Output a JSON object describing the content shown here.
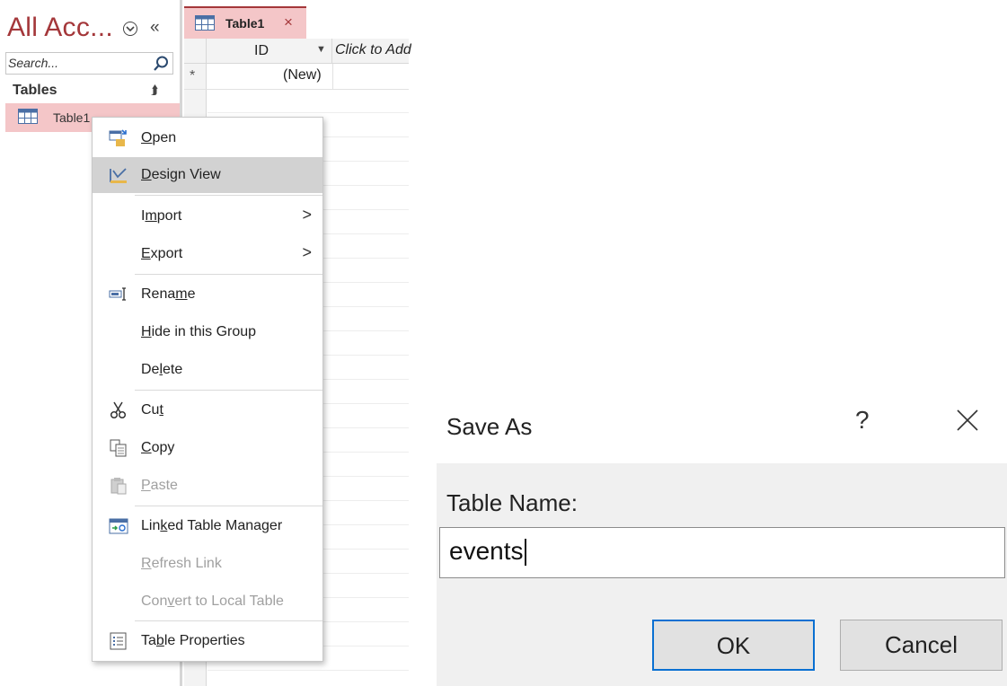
{
  "nav": {
    "title": "All Acc...",
    "search_placeholder": "Search...",
    "group_label": "Tables",
    "items": [
      {
        "label": "Table1",
        "selected": true
      }
    ]
  },
  "tab": {
    "label": "Table1",
    "close_glyph": "×"
  },
  "grid": {
    "columns": [
      {
        "label": "ID"
      },
      {
        "label": "Click to Add"
      }
    ],
    "new_row": {
      "marker": "*",
      "id_value": "(New)"
    }
  },
  "context_menu": {
    "items": [
      {
        "label": "Open",
        "access_key": "O",
        "icon": "open-table-icon",
        "enabled": true
      },
      {
        "label": "Design View",
        "access_key": "D",
        "icon": "design-view-icon",
        "enabled": true,
        "hovered": true
      },
      {
        "label": "Import",
        "access_key": "m",
        "enabled": true,
        "submenu": true
      },
      {
        "label": "Export",
        "access_key": "E",
        "enabled": true,
        "submenu": true
      },
      {
        "label": "Rename",
        "access_key": "m",
        "icon": "rename-icon",
        "enabled": true
      },
      {
        "label": "Hide in this Group",
        "access_key": "H",
        "enabled": true
      },
      {
        "label": "Delete",
        "access_key": "l",
        "enabled": true
      },
      {
        "label": "Cut",
        "access_key": "t",
        "icon": "scissors-icon",
        "enabled": true
      },
      {
        "label": "Copy",
        "access_key": "C",
        "icon": "copy-icon",
        "enabled": true
      },
      {
        "label": "Paste",
        "access_key": "P",
        "icon": "paste-icon",
        "enabled": false
      },
      {
        "label": "Linked Table Manager",
        "access_key": "k",
        "icon": "linked-table-manager-icon",
        "enabled": true
      },
      {
        "label": "Refresh Link",
        "access_key": "R",
        "enabled": false
      },
      {
        "label": "Convert to Local Table",
        "access_key": "v",
        "enabled": false
      },
      {
        "label": "Table Properties",
        "access_key": "b",
        "icon": "table-properties-icon",
        "enabled": true
      }
    ]
  },
  "dialog": {
    "title": "Save As",
    "help_glyph": "?",
    "field_label": "Table Name:",
    "input_value": "events",
    "ok_label": "OK",
    "cancel_label": "Cancel"
  },
  "colors": {
    "accent": "#a4373a",
    "selection": "#f4c6c8",
    "ok_focus": "#0a70d2"
  }
}
